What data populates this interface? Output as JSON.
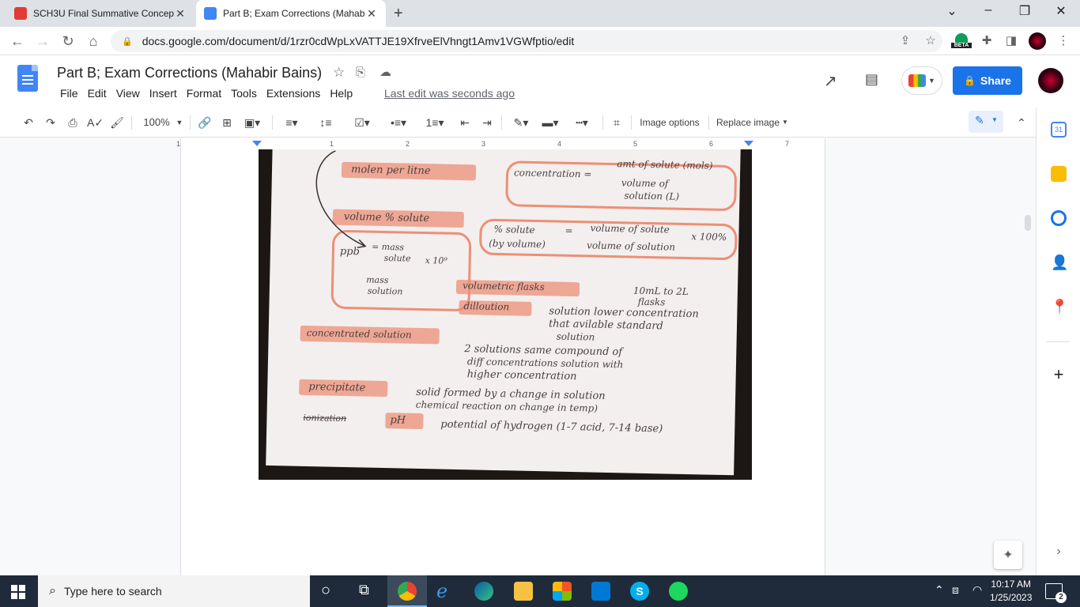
{
  "browser": {
    "tabs": [
      {
        "title": "SCH3U Final Summative Concept",
        "favicon_color": "#e53935"
      },
      {
        "title": "Part B; Exam Corrections (Mahabir",
        "favicon_color": "#4285f4"
      }
    ],
    "url": "docs.google.com/document/d/1rzr0cdWpLxVATTJE19XfrveElVhngt1Amv1VGWfptio/edit",
    "beta_label": "BETA"
  },
  "doc": {
    "title": "Part B; Exam Corrections (Mahabir Bains)",
    "menu": [
      "File",
      "Edit",
      "View",
      "Insert",
      "Format",
      "Tools",
      "Extensions",
      "Help"
    ],
    "last_edit": "Last edit was seconds ago",
    "share_label": "Share"
  },
  "toolbar": {
    "zoom": "100%",
    "image_options": "Image options",
    "replace_image": "Replace image"
  },
  "ruler": {
    "ticks": [
      "1",
      "1",
      "2",
      "3",
      "4",
      "5",
      "6",
      "7"
    ]
  },
  "photo": {
    "lines": [
      "molen per litne",
      "concentration =",
      "amt of solute (mols)",
      "volume of",
      "solution (L)",
      "volume % solute",
      "% solute",
      "=",
      "volume of solute",
      "x 100%",
      "(by volume)",
      "volume of solution",
      "ppb",
      "= mass",
      "solute",
      "x 10⁹",
      "mass",
      "solution",
      "volumetric flasks",
      "10mL to 2L",
      "flasks",
      "dilloution",
      "solution lower concentration",
      "that avilable standard",
      "solution",
      "concentrated solution",
      "2 solutions same compound of",
      "diff concentrations solution with",
      "higher concentration",
      "precipitate",
      "solid formed by a change in solution",
      "chemical reaction on change in temp)",
      "ionization",
      "pH",
      "potential of hydrogen (1-7 acid, 7-14 base)"
    ]
  },
  "taskbar": {
    "search_placeholder": "Type here to search",
    "time": "10:17 AM",
    "date": "1/25/2023",
    "notification_count": "2"
  },
  "colors": {
    "share_blue": "#1a73e8",
    "highlighter": "#ec8f76",
    "taskbar": "#1f2b3a"
  }
}
